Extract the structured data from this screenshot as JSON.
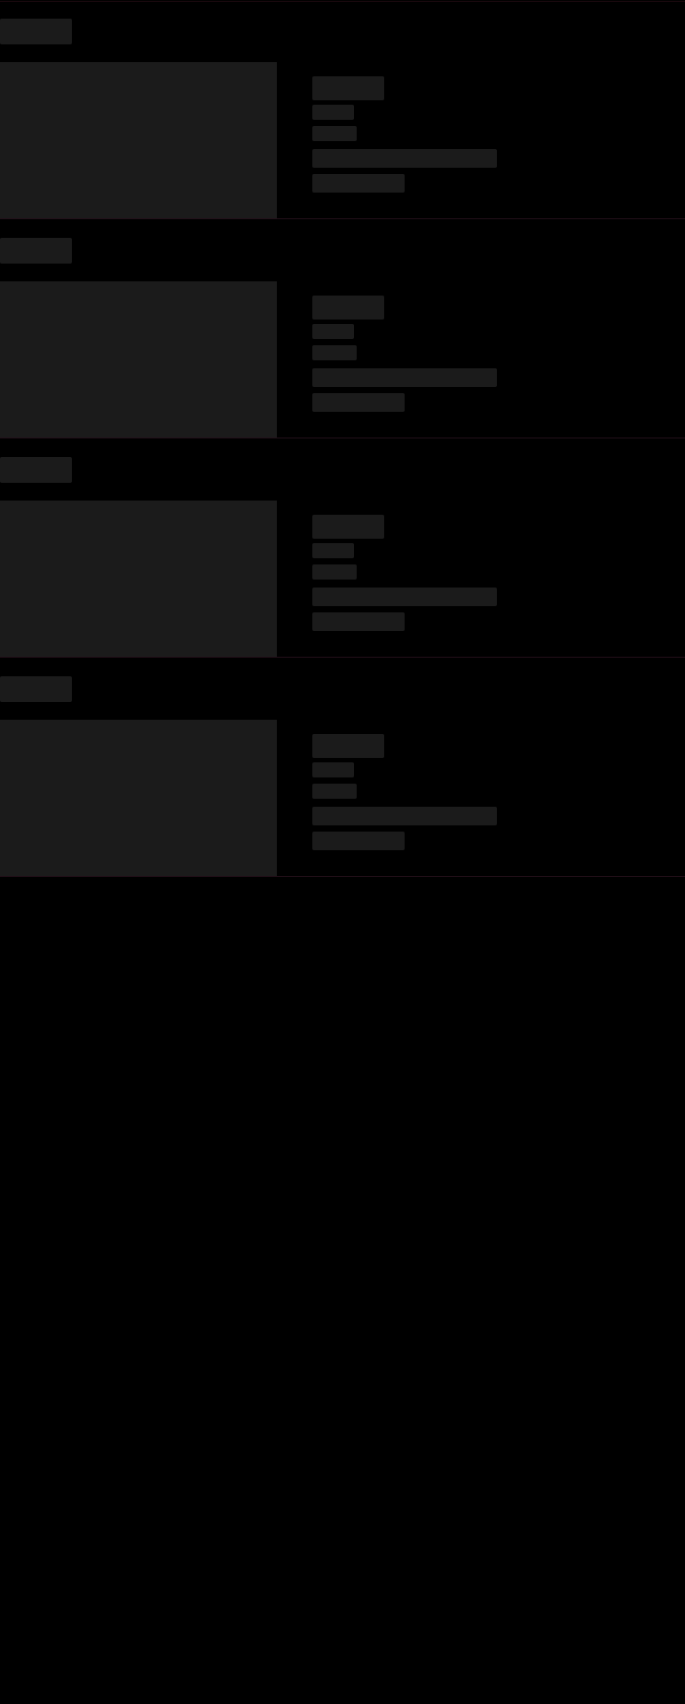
{
  "screen": {
    "background": "#000000",
    "placeholder_color": "#1b1b1b",
    "divider_color": "#24101a"
  },
  "loading_cards": [
    {
      "state": "loading"
    },
    {
      "state": "loading"
    },
    {
      "state": "loading"
    },
    {
      "state": "loading"
    }
  ]
}
